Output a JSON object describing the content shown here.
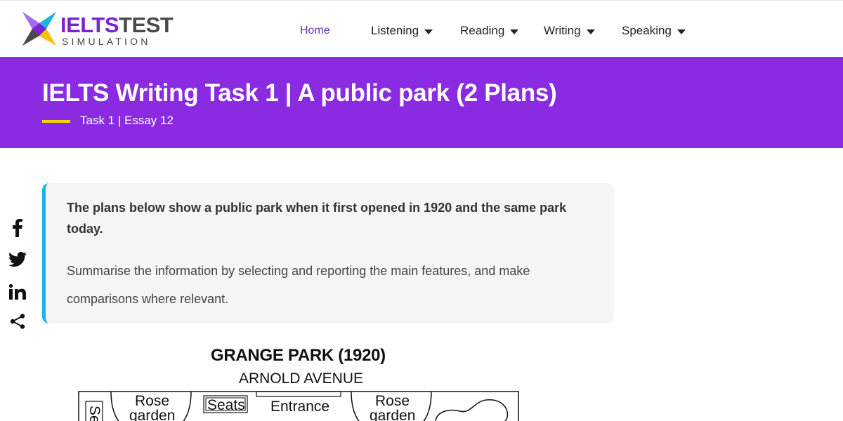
{
  "header": {
    "logo": {
      "text_part1": "IELTS",
      "text_part2": "TEST",
      "subtext": "SIMULATION",
      "icon": "star-logo-icon"
    },
    "nav": [
      {
        "label": "Home",
        "has_dropdown": false
      },
      {
        "label": "Listening",
        "has_dropdown": true
      },
      {
        "label": "Reading",
        "has_dropdown": true
      },
      {
        "label": "Writing",
        "has_dropdown": true
      },
      {
        "label": "Speaking",
        "has_dropdown": true
      }
    ]
  },
  "banner": {
    "title": "IELTS Writing Task 1 | A public park (2 Plans)",
    "subtitle": "Task 1 | Essay 12"
  },
  "social": [
    {
      "icon": "facebook-icon"
    },
    {
      "icon": "twitter-icon"
    },
    {
      "icon": "linkedin-icon"
    },
    {
      "icon": "share-icon"
    }
  ],
  "question": {
    "prompt": "The plans below show a public park when it first opened in 1920 and the same park today.",
    "instruction": "Summarise the information by selecting and reporting the main features, and make comparisons where relevant."
  },
  "plan": {
    "title": "GRANGE PARK (1920)",
    "street": "ARNOLD AVENUE",
    "labels": {
      "seats_side": "Se",
      "rose_garden_left_1": "Rose",
      "rose_garden_left_2": "garden",
      "seats": "Seats",
      "entrance": "Entrance",
      "rose_garden_right_1": "Rose",
      "rose_garden_right_2": "garden"
    }
  },
  "colors": {
    "brand_purple": "#8a2be2",
    "accent_yellow": "#f5d400",
    "accent_blue": "#1db3e6",
    "nav_active": "#6a2fb8"
  }
}
